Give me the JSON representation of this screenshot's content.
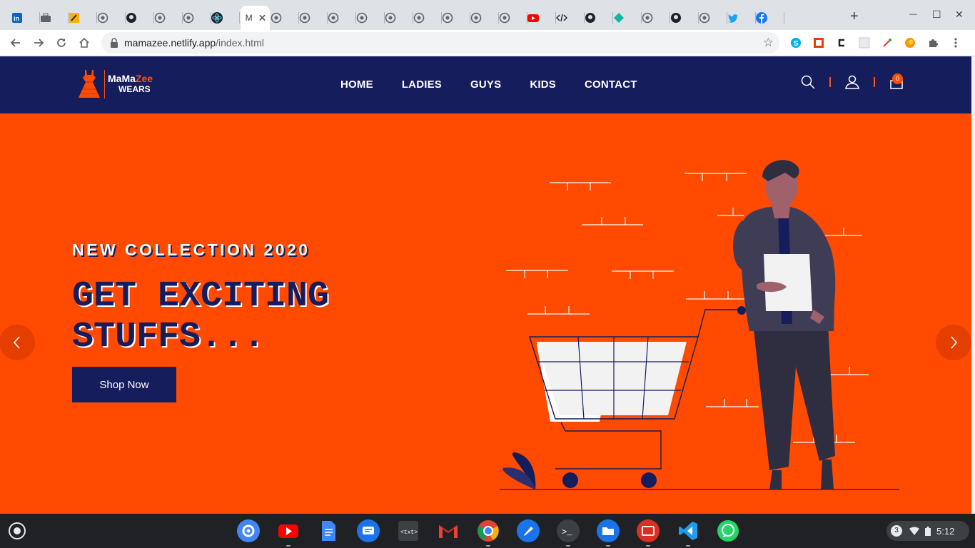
{
  "browser": {
    "tabs": [
      {
        "icon": "linkedin-icon",
        "color": "#0a66c2"
      },
      {
        "icon": "briefcase-icon",
        "color": "#5f6368"
      },
      {
        "icon": "pencil-icon",
        "color": "#f6b400"
      },
      {
        "icon": "globe-icon",
        "color": "#5f6368"
      },
      {
        "icon": "github-icon",
        "color": "#202124"
      },
      {
        "icon": "globe-icon",
        "color": "#5f6368"
      },
      {
        "icon": "globe-icon",
        "color": "#5f6368"
      },
      {
        "icon": "react-icon",
        "color": "#61dafb"
      },
      {
        "icon": "globe-icon",
        "color": "#5f6368"
      },
      {
        "icon": "globe-icon",
        "color": "#5f6368"
      },
      {
        "icon": "globe-icon",
        "color": "#5f6368"
      },
      {
        "icon": "globe-icon",
        "color": "#5f6368"
      },
      {
        "icon": "globe-icon",
        "color": "#5f6368"
      },
      {
        "icon": "globe-icon",
        "color": "#5f6368"
      },
      {
        "icon": "globe-icon",
        "color": "#5f6368"
      },
      {
        "icon": "globe-icon",
        "color": "#5f6368"
      },
      {
        "icon": "globe-icon",
        "color": "#5f6368"
      },
      {
        "icon": "youtube-icon",
        "color": "#ff0000"
      },
      {
        "icon": "code-icon",
        "color": "#202124"
      },
      {
        "icon": "github-icon",
        "color": "#202124"
      },
      {
        "icon": "diamond-icon",
        "color": "#12b5a5"
      },
      {
        "icon": "globe-icon",
        "color": "#5f6368"
      },
      {
        "icon": "github-icon",
        "color": "#202124"
      },
      {
        "icon": "globe-icon",
        "color": "#5f6368"
      },
      {
        "icon": "twitter-icon",
        "color": "#1da1f2"
      },
      {
        "icon": "facebook-icon",
        "color": "#1877f2"
      }
    ],
    "active_tab_title": "M",
    "active_tab_close": "✕",
    "new_tab": "+",
    "window_controls": {
      "minimize": "—",
      "maximize": "☐",
      "close": "✕"
    },
    "url_host": "mamazee.netlify.app",
    "url_path": "/index.html",
    "bookmark_star": "☆"
  },
  "site": {
    "logo": {
      "line1_a": "MaMa",
      "line1_b": "Zee",
      "line2": "WEARS"
    },
    "nav": [
      "HOME",
      "LADIES",
      "GUYS",
      "KIDS",
      "CONTACT"
    ],
    "cart_count": "0",
    "hero": {
      "subtitle": "NEW COLLECTION 2020",
      "title_line1": "GET EXCITING",
      "title_line2": "STUFFS...",
      "button": "Shop Now",
      "prev": "‹",
      "next": "›"
    },
    "colors": {
      "navy": "#161d5c",
      "orange": "#ff4a00"
    }
  },
  "os": {
    "apps": [
      "settings-icon",
      "youtube-app-icon",
      "docs-icon",
      "messages-icon",
      "text-editor-icon",
      "gmail-icon",
      "chrome-icon",
      "paint-icon",
      "terminal-icon",
      "files-icon",
      "screencast-icon",
      "vscode-icon",
      "whatsapp-icon"
    ],
    "notification_count": "3",
    "time": "5:12"
  }
}
